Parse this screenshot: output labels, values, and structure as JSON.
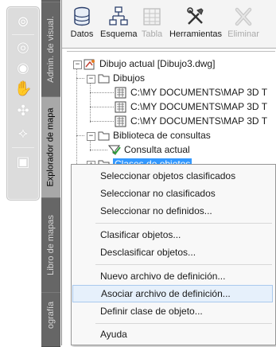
{
  "nav_bar": {
    "icons": [
      "steering-wheel-icon",
      "pan-icon",
      "zoom-icon",
      "hand-icon",
      "orbit-icon",
      "showmotion-icon",
      "play-icon"
    ]
  },
  "side_tabs": [
    {
      "label": "Admin. de visual.",
      "active": false
    },
    {
      "label": "Explorador de mapa",
      "active": true
    },
    {
      "label": "Libro de mapas",
      "active": false
    },
    {
      "label": "ografía",
      "active": false
    }
  ],
  "toolbar": {
    "buttons": [
      {
        "label": "Datos",
        "icon": "database-icon",
        "enabled": true
      },
      {
        "label": "Esquema",
        "icon": "schema-icon",
        "enabled": true
      },
      {
        "label": "Tabla",
        "icon": "table-icon",
        "enabled": false
      },
      {
        "label": "Herramientas",
        "icon": "tools-icon",
        "enabled": true
      },
      {
        "label": "Eliminar",
        "icon": "delete-icon",
        "enabled": false
      }
    ]
  },
  "tree": {
    "root": "Dibujo actual [Dibujo3.dwg]",
    "drawings_folder": "Dibujos",
    "drawings": [
      "C:\\MY DOCUMENTS\\MAP 3D T",
      "C:\\MY DOCUMENTS\\MAP 3D T",
      "C:\\MY DOCUMENTS\\MAP 3D T"
    ],
    "query_library": "Biblioteca de consultas",
    "current_query": "Consulta actual",
    "object_classes": "Clases de objetos"
  },
  "context_menu": {
    "items": [
      "Seleccionar objetos clasificados",
      "Seleccionar no clasificados",
      "Seleccionar no definidos...",
      "Clasificar objetos...",
      "Desclasificar objetos...",
      "Nuevo archivo de definición...",
      "Asociar archivo de definición...",
      "Definir clase de objeto...",
      "Ayuda"
    ],
    "highlighted_index": 6
  },
  "colors": {
    "selection": "#3399ff",
    "menu_hover": "#e6f0fb",
    "tab_strip": "#5f5f5f"
  }
}
